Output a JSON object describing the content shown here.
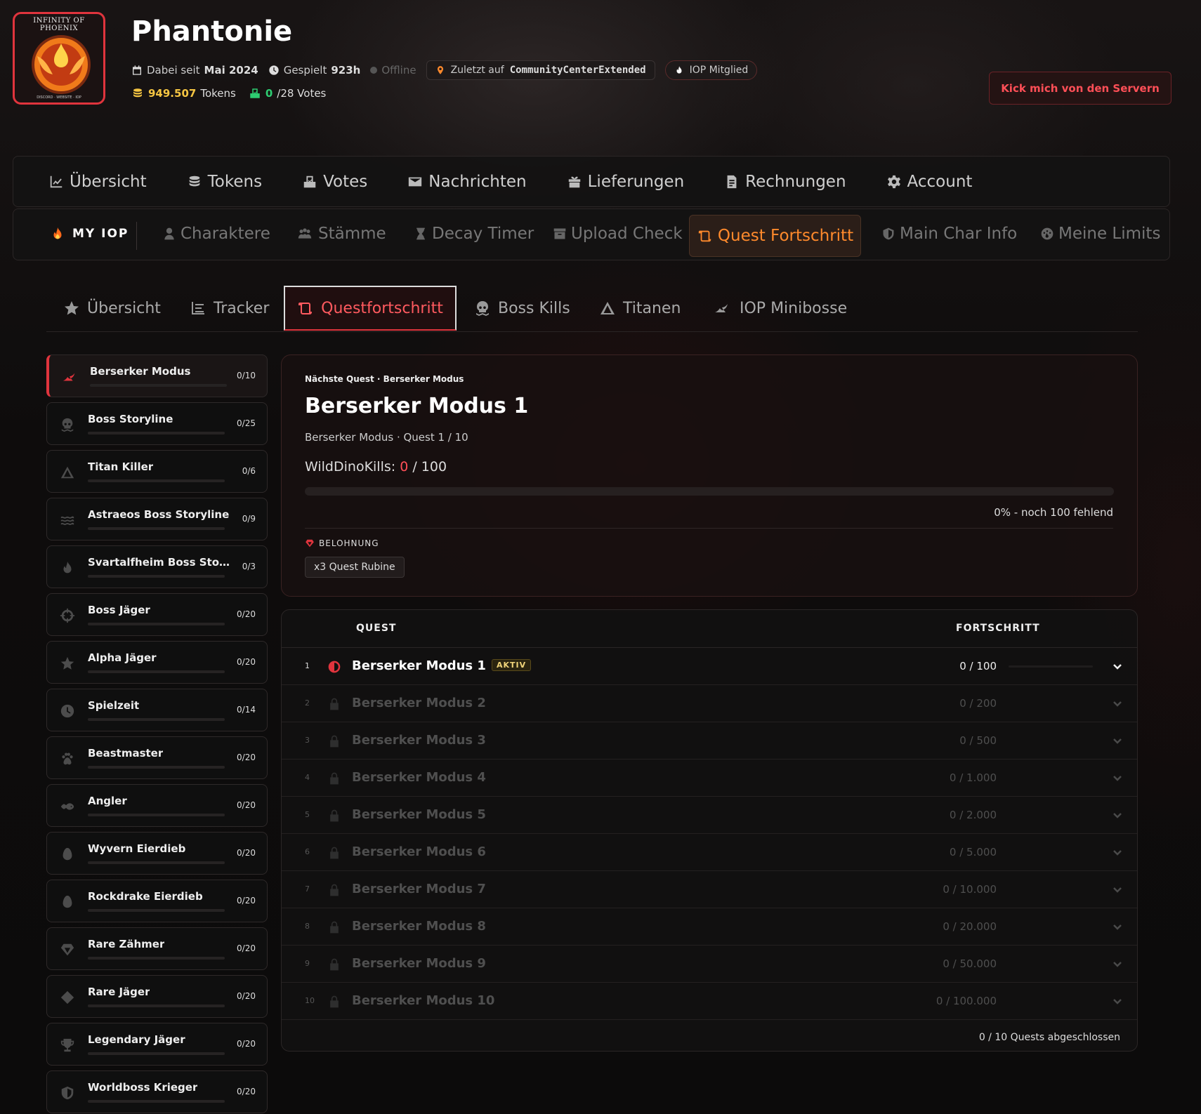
{
  "header": {
    "logo_text_top": "INFINITY OF PHOENIX",
    "logo_text_bottom": "DISCORD · WEBSITE · IOP",
    "username": "Phantonie",
    "since_label": "Dabei seit",
    "since_value": "Mai 2024",
    "played_label": "Gespielt",
    "played_value": "923h",
    "status": "Offline",
    "last_on_label": "Zuletzt auf",
    "last_on_value": "CommunityCenterExtended",
    "member_badge": "IOP Mitglied",
    "tokens_value": "949.507",
    "tokens_label": "Tokens",
    "votes_value": "0",
    "votes_suffix": "/28 Votes",
    "kick_button": "Kick mich von den Servern",
    "colors": {
      "accent": "#e0343d",
      "tokens": "#f5c542",
      "votes": "#2ecc71",
      "active_tab": "#ff8a2c"
    }
  },
  "nav1": [
    {
      "label": "Übersicht",
      "icon": "chart-line-icon"
    },
    {
      "label": "Tokens",
      "icon": "coins-icon"
    },
    {
      "label": "Votes",
      "icon": "vote-box-icon"
    },
    {
      "label": "Nachrichten",
      "icon": "envelope-icon"
    },
    {
      "label": "Lieferungen",
      "icon": "gift-icon"
    },
    {
      "label": "Rechnungen",
      "icon": "invoice-icon"
    },
    {
      "label": "Account",
      "icon": "gear-icon"
    }
  ],
  "nav2": {
    "my_iop": "MY IOP",
    "items": [
      {
        "label": "Charaktere",
        "icon": "user-icon"
      },
      {
        "label": "Stämme",
        "icon": "users-icon"
      },
      {
        "label": "Decay Timer",
        "icon": "hourglass-icon"
      },
      {
        "label": "Upload Check",
        "icon": "archive-icon"
      },
      {
        "label": "Quest Fortschritt",
        "icon": "scroll-icon"
      },
      {
        "label": "Main Char Info",
        "icon": "shield-icon"
      },
      {
        "label": "Meine Limits",
        "icon": "gauge-icon"
      }
    ]
  },
  "subtabs": [
    {
      "label": "Übersicht",
      "icon": "star-icon"
    },
    {
      "label": "Tracker",
      "icon": "list-icon"
    },
    {
      "label": "Questfortschritt",
      "icon": "scroll-icon"
    },
    {
      "label": "Boss Kills",
      "icon": "skull-icon"
    },
    {
      "label": "Titanen",
      "icon": "mountain-icon"
    },
    {
      "label": "IOP Minibosse",
      "icon": "dragon-icon"
    }
  ],
  "categories": [
    {
      "label": "Berserker Modus",
      "count": "0/10",
      "progress": 0
    },
    {
      "label": "Boss Storyline",
      "count": "0/25",
      "progress": 0
    },
    {
      "label": "Titan Killer",
      "count": "0/6",
      "progress": 0
    },
    {
      "label": "Astraeos Boss Storyline",
      "count": "0/9",
      "progress": 0
    },
    {
      "label": "Svartalfheim Boss Storyline",
      "count": "0/3",
      "progress": 0
    },
    {
      "label": "Boss Jäger",
      "count": "0/20",
      "progress": 0
    },
    {
      "label": "Alpha Jäger",
      "count": "0/20",
      "progress": 0
    },
    {
      "label": "Spielzeit",
      "count": "0/14",
      "progress": 0
    },
    {
      "label": "Beastmaster",
      "count": "0/20",
      "progress": 0
    },
    {
      "label": "Angler",
      "count": "0/20",
      "progress": 0
    },
    {
      "label": "Wyvern Eierdieb",
      "count": "0/20",
      "progress": 0
    },
    {
      "label": "Rockdrake Eierdieb",
      "count": "0/20",
      "progress": 0
    },
    {
      "label": "Rare Zähmer",
      "count": "0/20",
      "progress": 0
    },
    {
      "label": "Rare Jäger",
      "count": "0/20",
      "progress": 0
    },
    {
      "label": "Legendary Jäger",
      "count": "0/20",
      "progress": 0
    },
    {
      "label": "Worldboss Krieger",
      "count": "0/20",
      "progress": 0
    }
  ],
  "next_quest": {
    "kicker": "Nächste Quest · Berserker Modus",
    "title": "Berserker Modus 1",
    "subtitle": "Berserker Modus · Quest 1 / 10",
    "metric_label": "WildDinoKills:",
    "metric_current": "0",
    "metric_total": "/ 100",
    "progress": 0,
    "progress_text": "0% - noch 100 fehlend",
    "reward_label": "BELOHNUNG",
    "reward": "x3 Quest Rubine"
  },
  "quest_table": {
    "col_quest": "QUEST",
    "col_progress": "FORTSCHRITT",
    "active_badge": "AKTIV",
    "rows": [
      {
        "n": "1",
        "name": "Berserker Modus 1",
        "value": "0 / 100"
      },
      {
        "n": "2",
        "name": "Berserker Modus 2",
        "value": "0 / 200"
      },
      {
        "n": "3",
        "name": "Berserker Modus 3",
        "value": "0 / 500"
      },
      {
        "n": "4",
        "name": "Berserker Modus 4",
        "value": "0 / 1.000"
      },
      {
        "n": "5",
        "name": "Berserker Modus 5",
        "value": "0 / 2.000"
      },
      {
        "n": "6",
        "name": "Berserker Modus 6",
        "value": "0 / 5.000"
      },
      {
        "n": "7",
        "name": "Berserker Modus 7",
        "value": "0 / 10.000"
      },
      {
        "n": "8",
        "name": "Berserker Modus 8",
        "value": "0 / 20.000"
      },
      {
        "n": "9",
        "name": "Berserker Modus 9",
        "value": "0 / 50.000"
      },
      {
        "n": "10",
        "name": "Berserker Modus 10",
        "value": "0 / 100.000"
      }
    ],
    "footer": "0 / 10 Quests abgeschlossen"
  }
}
